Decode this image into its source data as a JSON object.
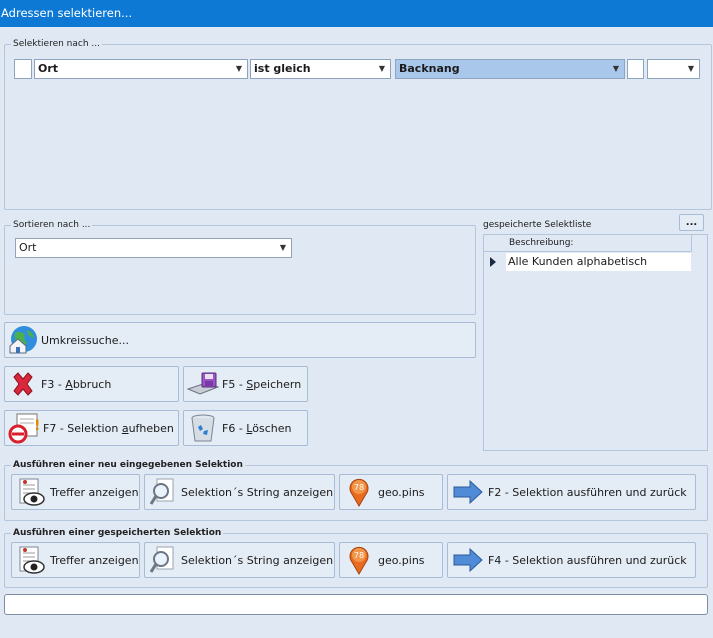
{
  "window": {
    "title": "Adressen selektieren..."
  },
  "select_group": {
    "legend": "Selektieren nach ...",
    "field": "Ort",
    "operator": "ist gleich",
    "value": "Backnang",
    "extra": ""
  },
  "sort_group": {
    "legend": "Sortieren nach ...",
    "field": "Ort"
  },
  "saved": {
    "label": "gespeicherte Selektliste",
    "more_button": "...",
    "column_header": "Beschreibung:",
    "rows": [
      "Alle Kunden alphabetisch"
    ]
  },
  "buttons": {
    "umkreis": "Umkreissuche...",
    "abbruch_pre": "F3 - ",
    "abbruch_u": "A",
    "abbruch_post": "bbruch",
    "speichern_pre": "F5 - ",
    "speichern_u": "S",
    "speichern_post": "peichern",
    "aufheben_pre": "F7 - Selektion ",
    "aufheben_u": "a",
    "aufheben_post": "ufheben",
    "loeschen_pre": "F6 - ",
    "loeschen_u": "L",
    "loeschen_post": "öschen"
  },
  "exec_new": {
    "legend": "Ausführen einer neu eingegebenen Selektion",
    "treffer": "Treffer anzeigen",
    "string": "Selektion´s String anzeigen",
    "geo": "geo.pins",
    "execute": "F2 - Selektion ausführen und zurück"
  },
  "exec_saved": {
    "legend": "Ausführen einer gespeicherten Selektion",
    "treffer": "Treffer anzeigen",
    "string": "Selektion´s String anzeigen",
    "geo": "geo.pins",
    "execute": "F4 - Selektion ausführen und zurück"
  },
  "geo_badge": "78"
}
